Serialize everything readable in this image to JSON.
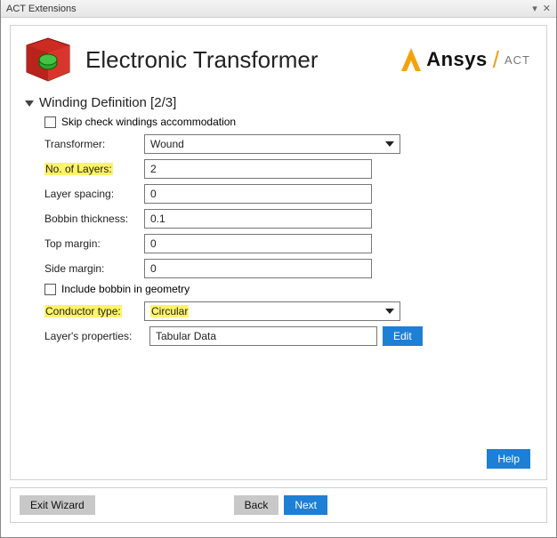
{
  "window": {
    "title": "ACT Extensions"
  },
  "header": {
    "app_title": "Electronic Transformer",
    "brand_name": "Ansys",
    "brand_sub": "ACT"
  },
  "section": {
    "title": "Winding Definition [2/3]"
  },
  "fields": {
    "skip_check_label": "Skip check windings accommodation",
    "skip_check_value": false,
    "transformer_label": "Transformer:",
    "transformer_value": "Wound",
    "layers_label": "No. of Layers:",
    "layers_value": "2",
    "layer_spacing_label": "Layer spacing:",
    "layer_spacing_value": "0",
    "bobbin_thickness_label": "Bobbin thickness:",
    "bobbin_thickness_value": "0.1",
    "top_margin_label": "Top margin:",
    "top_margin_value": "0",
    "side_margin_label": "Side margin:",
    "side_margin_value": "0",
    "include_bobbin_label": "Include bobbin in geometry",
    "include_bobbin_value": false,
    "conductor_type_label": "Conductor type:",
    "conductor_type_value": "Circular",
    "layers_props_label": "Layer's properties:",
    "layers_props_value": "Tabular Data",
    "edit_label": "Edit"
  },
  "buttons": {
    "help": "Help",
    "exit": "Exit Wizard",
    "back": "Back",
    "next": "Next"
  }
}
